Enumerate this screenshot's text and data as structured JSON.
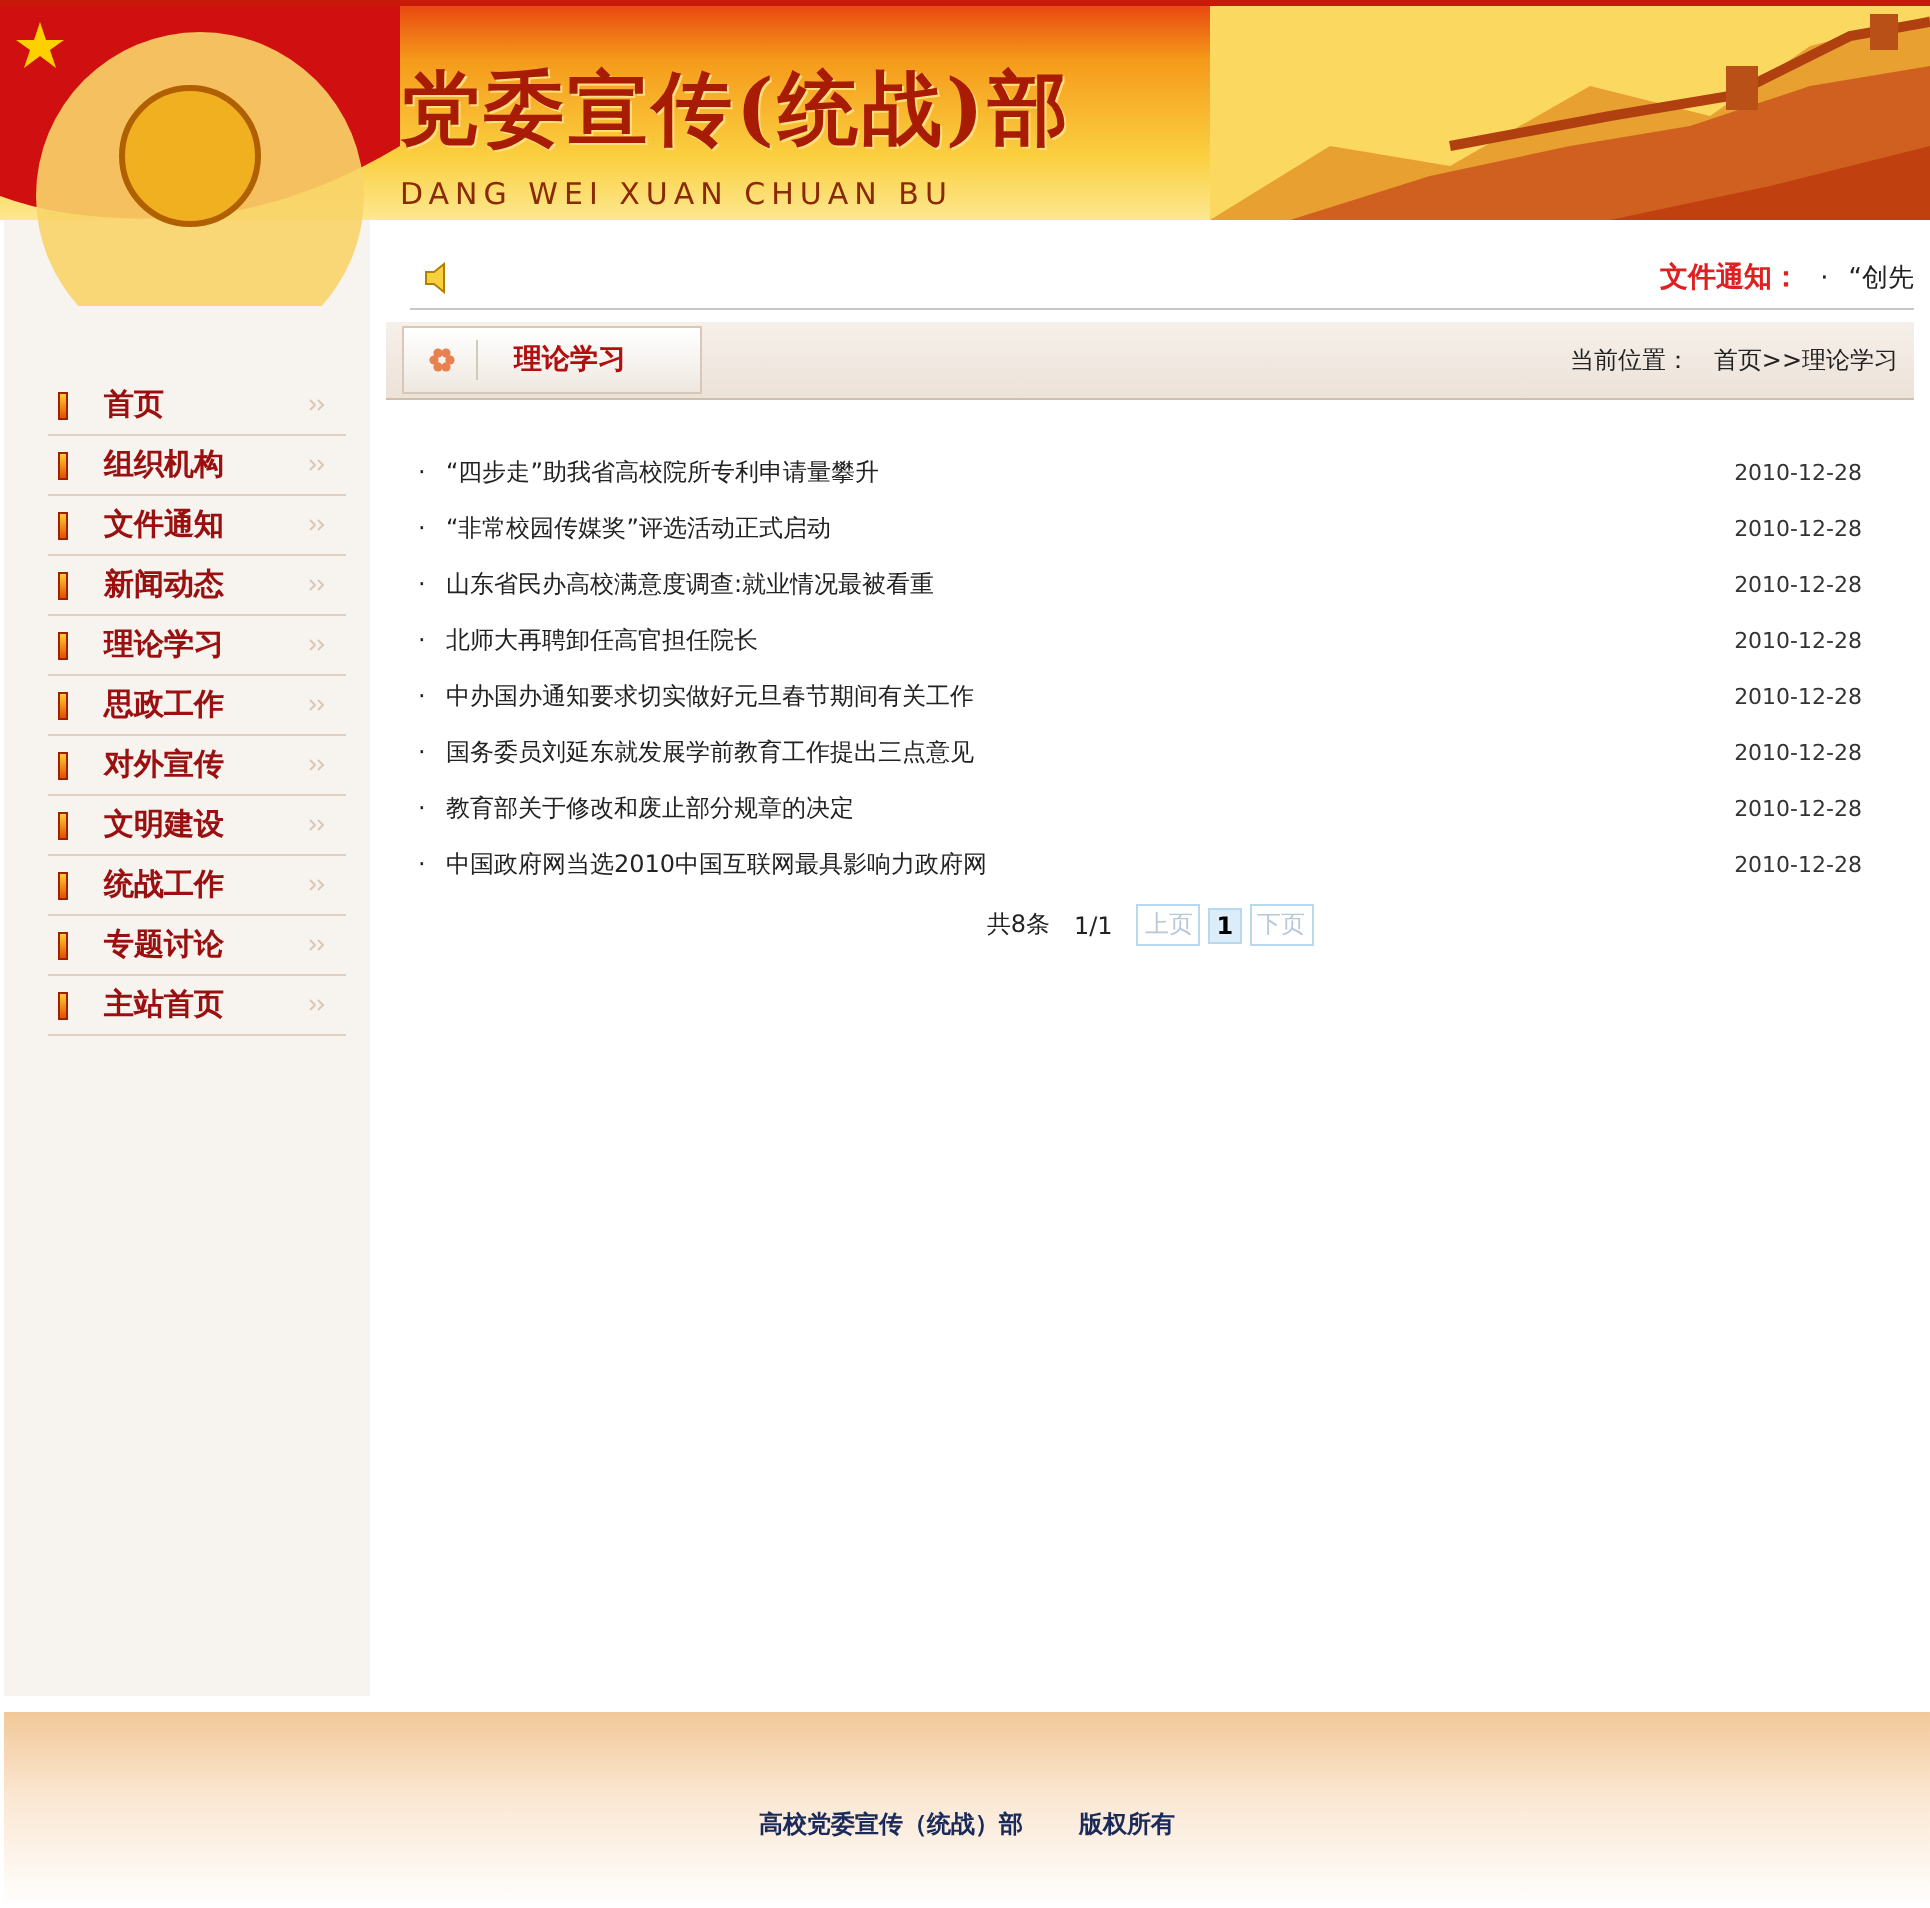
{
  "header": {
    "title": "党委宣传(统战)部",
    "subtitle": "DANG WEI XUAN CHUAN BU"
  },
  "notice": {
    "label": "文件通知：",
    "bullet": "·",
    "text": "“创先"
  },
  "nav": [
    {
      "label": "首页"
    },
    {
      "label": "组织机构"
    },
    {
      "label": "文件通知"
    },
    {
      "label": "新闻动态"
    },
    {
      "label": "理论学习"
    },
    {
      "label": "思政工作"
    },
    {
      "label": "对外宣传"
    },
    {
      "label": "文明建设"
    },
    {
      "label": "统战工作"
    },
    {
      "label": "专题讨论"
    },
    {
      "label": "主站首页"
    }
  ],
  "section": {
    "title": "理论学习",
    "location_label": "当前位置：",
    "location": "首页>>理论学习"
  },
  "articles": [
    {
      "bullet": "·",
      "title": "“四步走”助我省高校院所专利申请量攀升",
      "date": "2010-12-28"
    },
    {
      "bullet": "·",
      "title": "“非常校园传媒奖”评选活动正式启动",
      "date": "2010-12-28"
    },
    {
      "bullet": "·",
      "title": "山东省民办高校满意度调查:就业情况最被看重",
      "date": "2010-12-28"
    },
    {
      "bullet": "·",
      "title": "北师大再聘卸任高官担任院长",
      "date": "2010-12-28"
    },
    {
      "bullet": "·",
      "title": "中办国办通知要求切实做好元旦春节期间有关工作",
      "date": "2010-12-28"
    },
    {
      "bullet": "·",
      "title": "国务委员刘延东就发展学前教育工作提出三点意见",
      "date": "2010-12-28"
    },
    {
      "bullet": "·",
      "title": "教育部关于修改和废止部分规章的决定",
      "date": "2010-12-28"
    },
    {
      "bullet": "·",
      "title": "中国政府网当选2010中国互联网最具影响力政府网",
      "date": "2010-12-28"
    }
  ],
  "pagination": {
    "total": "共8条",
    "pages": "1/1",
    "prev": {
      "label": "上页",
      "disabled": true
    },
    "page_buttons": [
      {
        "label": "1",
        "selected": true
      }
    ],
    "next": {
      "label": "下页",
      "disabled": true
    }
  },
  "footer": {
    "org": "高校党委宣传（统战）部",
    "rights": "版权所有"
  }
}
